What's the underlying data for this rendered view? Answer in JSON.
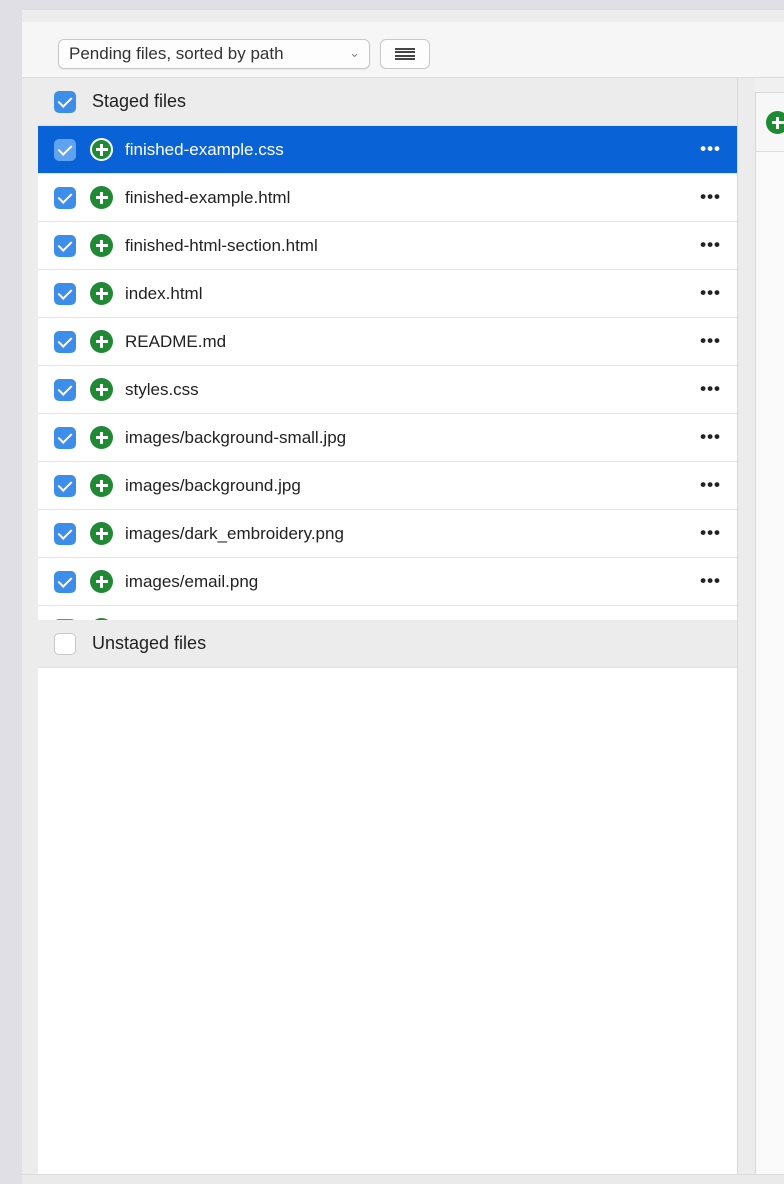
{
  "toolbar": {
    "view_mode": "Pending files, sorted by path",
    "view_mode_chevron": "chevron-down-icon",
    "list_toggle_icon": "list-icon"
  },
  "staged": {
    "label": "Staged files",
    "checked": true,
    "files": [
      {
        "name": "finished-example.css",
        "status": "added",
        "checked": true,
        "selected": true
      },
      {
        "name": "finished-example.html",
        "status": "added",
        "checked": true
      },
      {
        "name": "finished-html-section.html",
        "status": "added",
        "checked": true
      },
      {
        "name": "index.html",
        "status": "added",
        "checked": true
      },
      {
        "name": "README.md",
        "status": "added",
        "checked": true
      },
      {
        "name": "styles.css",
        "status": "added",
        "checked": true
      },
      {
        "name": "images/background-small.jpg",
        "status": "added",
        "checked": true
      },
      {
        "name": "images/background.jpg",
        "status": "added",
        "checked": true
      },
      {
        "name": "images/dark_embroidery.png",
        "status": "added",
        "checked": true
      },
      {
        "name": "images/email.png",
        "status": "added",
        "checked": true
      }
    ],
    "more_label": "•••"
  },
  "unstaged": {
    "label": "Unstaged files",
    "checked": false
  },
  "colors": {
    "selection": "#0a63d6",
    "checkbox": "#3d8ee8",
    "added_icon": "#1e8a34"
  }
}
